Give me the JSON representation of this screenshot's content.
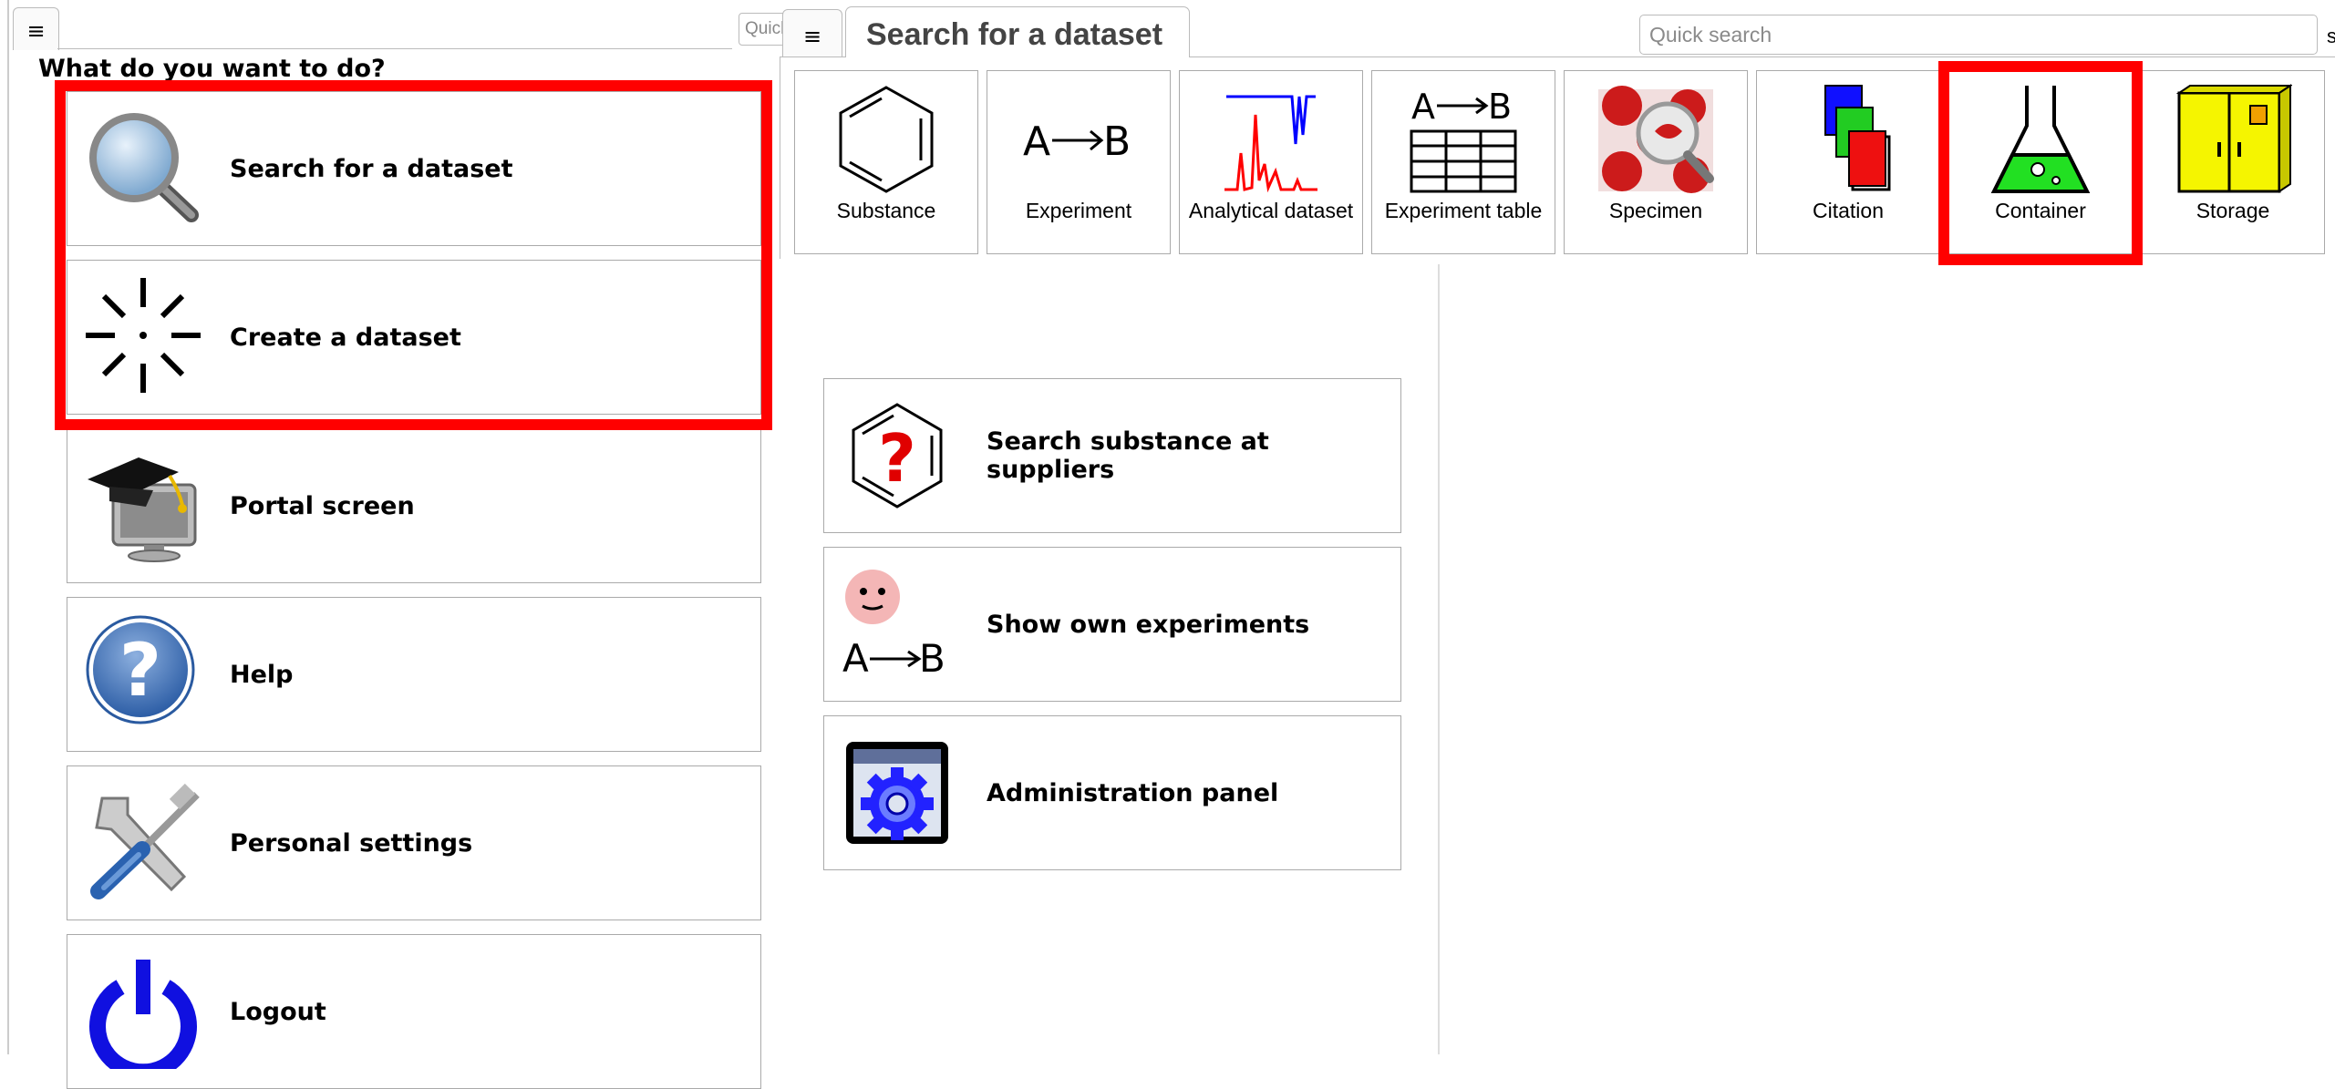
{
  "left": {
    "menu_icon": "≡",
    "quick_search_placeholder": "Quick search",
    "heading": "What do you want to do?",
    "items": [
      {
        "label": "Search for a dataset",
        "icon": "magnifier-icon"
      },
      {
        "label": "Create a dataset",
        "icon": "sparkle-icon"
      },
      {
        "label": "Portal screen",
        "icon": "graduation-monitor-icon"
      },
      {
        "label": "Help",
        "icon": "help-icon"
      },
      {
        "label": "Personal settings",
        "icon": "tools-icon"
      },
      {
        "label": "Logout",
        "icon": "power-icon"
      }
    ]
  },
  "right": {
    "menu_icon": "≡",
    "title": "Search for a dataset",
    "quick_search_placeholder": "Quick search",
    "edge_text": "s",
    "types": [
      {
        "label": "Substance",
        "icon": "benzene-icon"
      },
      {
        "label": "Experiment",
        "icon": "reaction-arrow-icon"
      },
      {
        "label": "Analytical dataset",
        "icon": "spectrum-icon"
      },
      {
        "label": "Experiment table",
        "icon": "reaction-table-icon"
      },
      {
        "label": "Specimen",
        "icon": "specimen-icon"
      },
      {
        "label": "Citation",
        "icon": "citation-icon"
      },
      {
        "label": "Container",
        "icon": "flask-icon"
      },
      {
        "label": "Storage",
        "icon": "cabinet-icon"
      }
    ],
    "actions": [
      {
        "label": "Search substance at suppliers",
        "icon": "benzene-question-icon"
      },
      {
        "label": "Show own experiments",
        "icon": "own-experiments-icon"
      },
      {
        "label": "Administration panel",
        "icon": "admin-gear-icon"
      }
    ]
  },
  "colors": {
    "highlight": "#ff0000",
    "flask": "#22e022",
    "cabinet": "#f5f500",
    "power": "#1010e0"
  }
}
